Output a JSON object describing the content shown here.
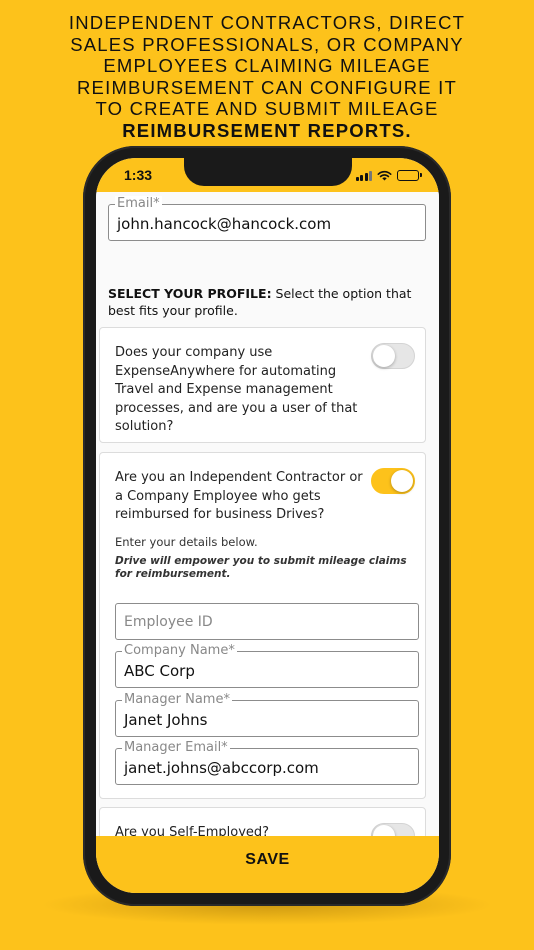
{
  "headline": {
    "lines": [
      "INDEPENDENT CONTRACTORS, DIRECT",
      "SALES PROFESSIONALS, OR COMPANY",
      "EMPLOYEES CLAIMING MILEAGE",
      "REIMBURSEMENT CAN CONFIGURE IT",
      "TO CREATE AND SUBMIT MILEAGE"
    ],
    "bold_line": "REIMBURSEMENT REPORTS."
  },
  "statusbar": {
    "time": "1:33",
    "icons": [
      "signal-icon",
      "wifi-icon",
      "battery-icon"
    ]
  },
  "form": {
    "email": {
      "label": "Email*",
      "value": "john.hancock@hancock.com"
    },
    "profile_heading": "SELECT YOUR PROFILE:",
    "profile_text": " Select the option that best fits your profile.",
    "option_expense": {
      "question": "Does your company use ExpenseAnywhere for automating Travel and Expense management processes, and are you a user of that solution?",
      "enabled": false
    },
    "option_contractor": {
      "question": "Are you an Independent Contractor or a Company Employee who gets reimbursed for business Drives?",
      "enabled": true,
      "hint": "Enter your details below.",
      "hint_italic": "Drive will empower you to submit mileage claims for reimbursement.",
      "employee_id": {
        "placeholder": "Employee ID",
        "value": ""
      },
      "company_name": {
        "label": "Company Name*",
        "value": "ABC Corp"
      },
      "manager_name": {
        "label": "Manager Name*",
        "value": "Janet Johns"
      },
      "manager_email": {
        "label": "Manager Email*",
        "value": "janet.johns@abccorp.com"
      }
    },
    "option_self_employed": {
      "question": "Are you Self-Employed?",
      "enabled": false
    }
  },
  "save_label": "SAVE",
  "colors": {
    "accent": "#fdc21b",
    "toggle_off": "#e6e6e6",
    "phone_frame": "#1a1a1a"
  }
}
